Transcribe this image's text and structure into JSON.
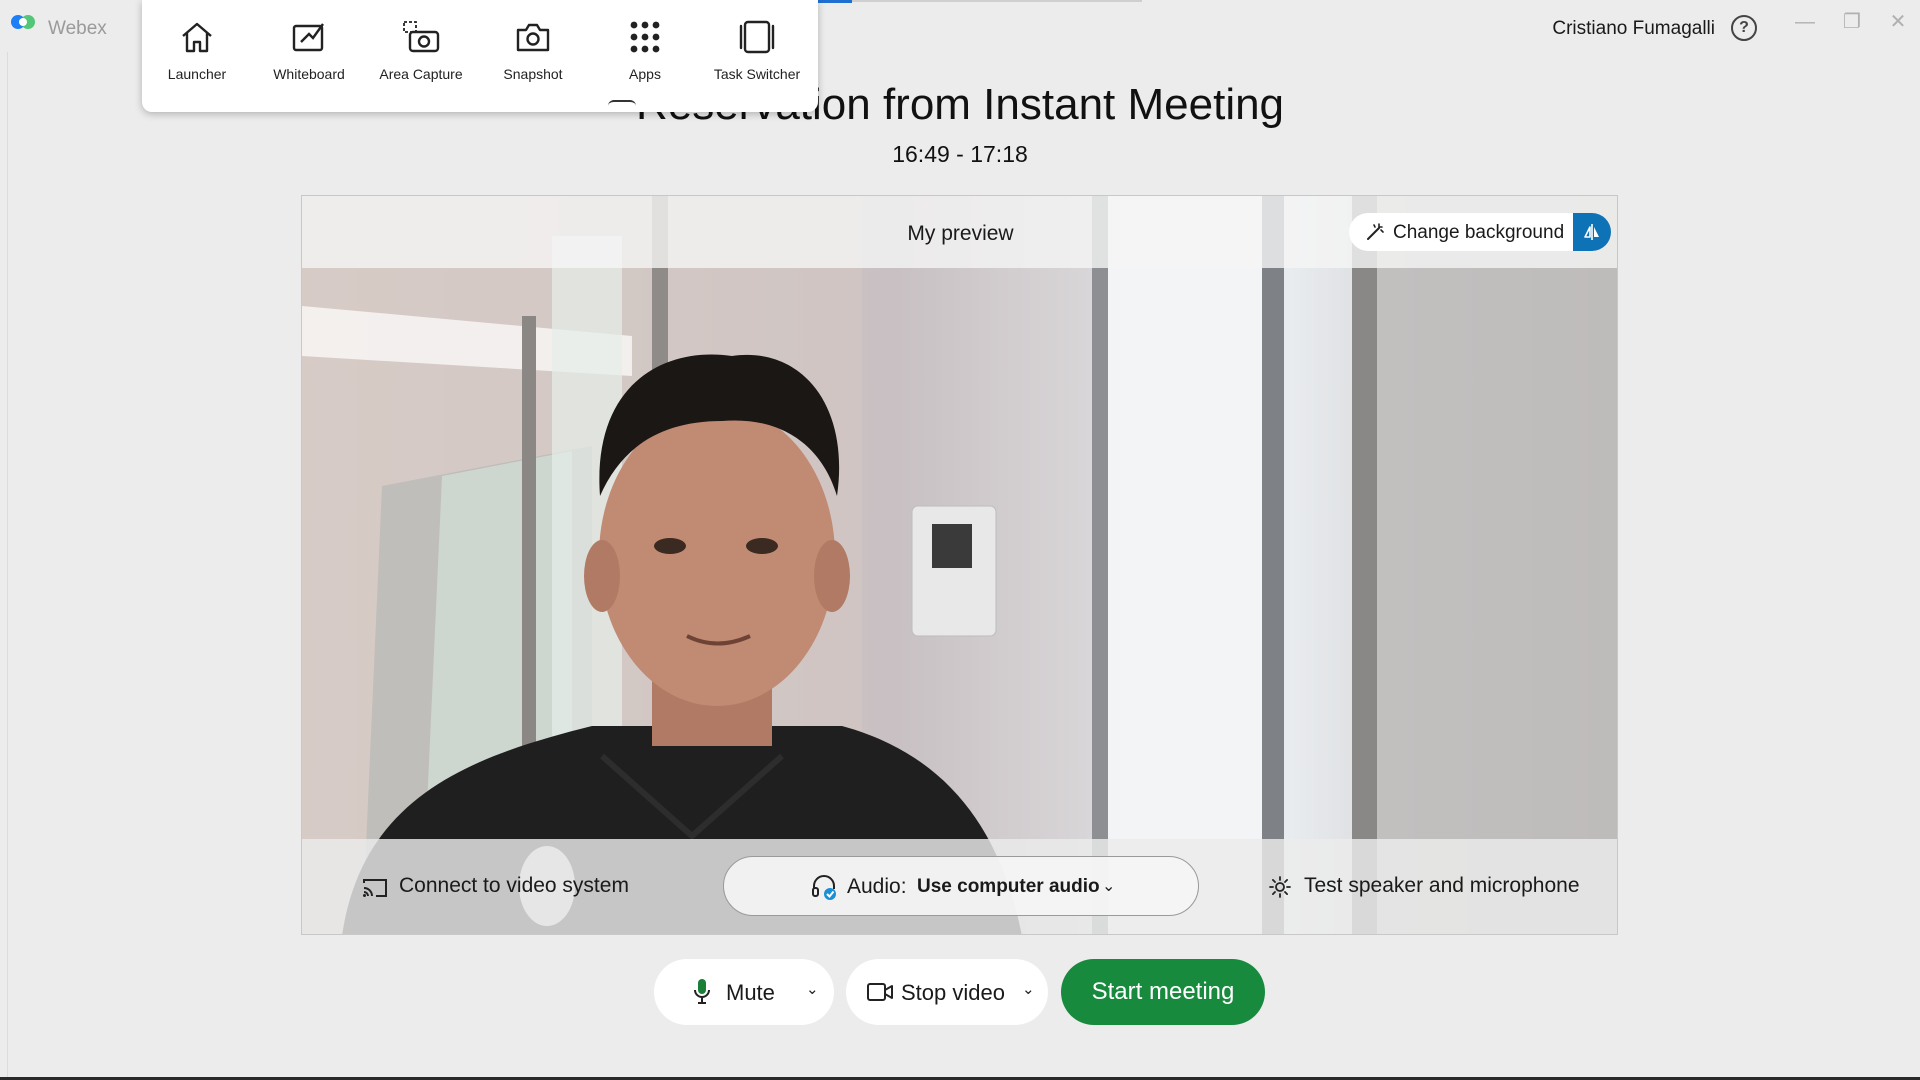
{
  "window": {
    "app_name": "Webex",
    "user_name": "Cristiano Fumagalli",
    "help_icon": "help-circle-icon",
    "controls": {
      "minimize": "—",
      "maximize": "❐",
      "close": "✕"
    }
  },
  "toolbar": {
    "tools": [
      {
        "label": "Launcher",
        "icon": "home-icon"
      },
      {
        "label": "Whiteboard",
        "icon": "whiteboard-icon"
      },
      {
        "label": "Area Capture",
        "icon": "area-capture-icon"
      },
      {
        "label": "Snapshot",
        "icon": "camera-icon"
      },
      {
        "label": "Apps",
        "icon": "apps-grid-icon"
      },
      {
        "label": "Task Switcher",
        "icon": "task-switcher-icon"
      }
    ]
  },
  "meeting": {
    "title": "Reservation from Instant Meeting",
    "time": "16:49 - 17:18"
  },
  "preview": {
    "title": "My preview",
    "change_background": "Change background",
    "connect_label": "Connect to video system",
    "audio_prefix": "Audio:",
    "audio_value": "Use computer audio",
    "test_label": "Test speaker and microphone"
  },
  "controls": {
    "mute_label": "Mute",
    "video_label": "Stop video",
    "start_label": "Start meeting"
  },
  "colors": {
    "accent": "#0d73b6",
    "start_green": "#178a3e",
    "mic_green": "#1a7f37",
    "tab_blue": "#1f6fd0"
  }
}
